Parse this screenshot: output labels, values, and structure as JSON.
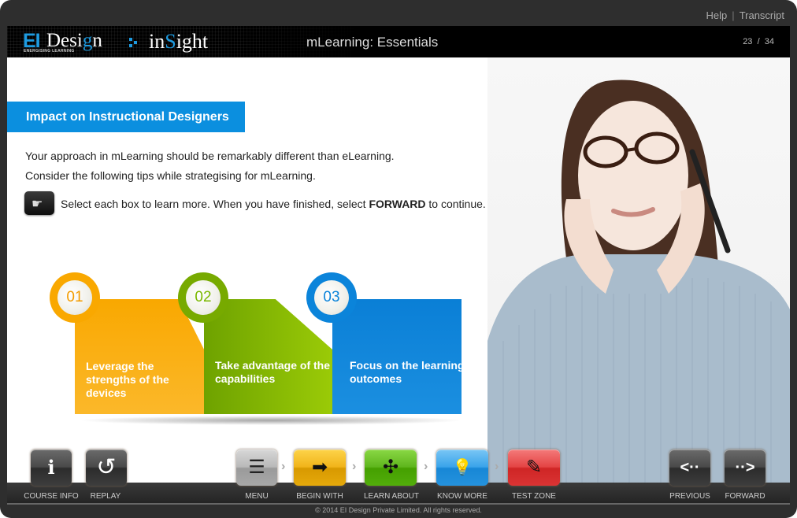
{
  "top_links": {
    "help": "Help",
    "separator": "|",
    "transcript": "Transcript"
  },
  "header": {
    "logo": {
      "ei": "EI",
      "design": "Desi",
      "design_g": "g",
      "design_end": "n",
      "tagline": "ENERGISING LEARNING",
      "insight_a": "in",
      "insight_s": "S",
      "insight_b": "ight"
    },
    "course_title": "mLearning: Essentials",
    "page_current": "23",
    "page_separator": "/",
    "page_total": "34"
  },
  "content": {
    "title": "Impact on Instructional Designers",
    "paragraph_1": "Your approach in mLearning should be remarkably different than eLearning.",
    "paragraph_2": "Consider the following tips while strategising for mLearning.",
    "instruction_icon": "hand-pointer-icon",
    "instruction_pre": "Select each box to learn more. When you have finished, select ",
    "instruction_bold": "FORWARD",
    "instruction_post": " to continue.",
    "cards": [
      {
        "number": "01",
        "text": "Leverage the strengths of the devices",
        "color": "#f9a800"
      },
      {
        "number": "02",
        "text": "Take advantage of the capabilities",
        "color": "#77aa00"
      },
      {
        "number": "03",
        "text": "Focus on the learning outcomes",
        "color": "#0b84da"
      }
    ],
    "photo": "woman-with-glasses-thinking"
  },
  "nav": {
    "course_info": {
      "label": "COURSE INFO",
      "icon": "info-icon",
      "glyph": "i"
    },
    "replay": {
      "label": "REPLAY",
      "icon": "replay-icon",
      "glyph": "↺"
    },
    "menu": {
      "label": "MENU",
      "icon": "list-icon",
      "glyph": "☰"
    },
    "begin_with": {
      "label": "BEGIN WITH",
      "icon": "arrow-right-icon",
      "glyph": "➡"
    },
    "learn_about": {
      "label": "LEARN ABOUT",
      "icon": "compress-icon",
      "glyph": "✣"
    },
    "know_more": {
      "label": "KNOW MORE",
      "icon": "lightbulb-icon",
      "glyph": "💡"
    },
    "test_zone": {
      "label": "TEST ZONE",
      "icon": "eraser-icon",
      "glyph": "✎"
    },
    "previous": {
      "label": "PREVIOUS",
      "icon": "previous-icon",
      "glyph": "<··"
    },
    "forward": {
      "label": "FORWARD",
      "icon": "forward-icon",
      "glyph": "··>"
    },
    "chevron": "›"
  },
  "footer": {
    "copyright": "© 2014 EI Design Private Limited. All rights reserved."
  }
}
